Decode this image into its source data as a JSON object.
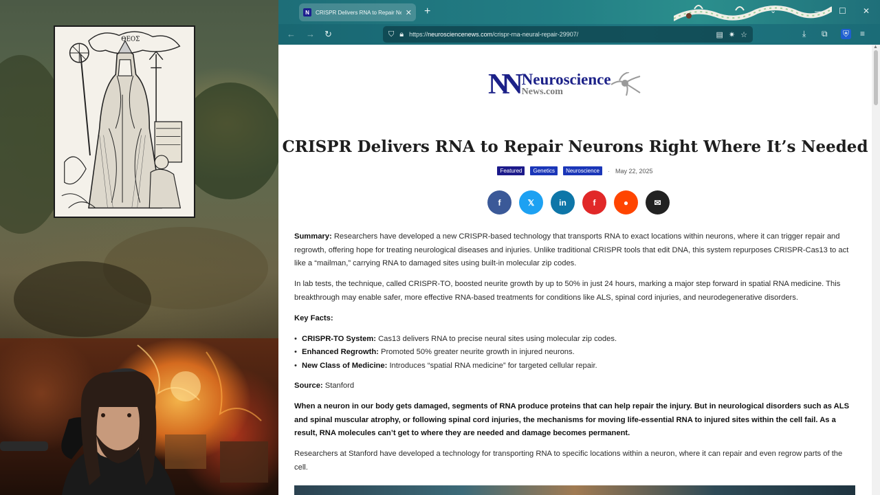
{
  "browser": {
    "tab_title": "CRISPR Delivers RNA to Repair Neurons Right Where It's Needed",
    "favicon_text": "N",
    "url_prefix": "https://",
    "url_host": "neurosciencenews.com",
    "url_path": "/crispr-rna-neural-repair-29907/"
  },
  "site": {
    "logo_mark": "NN",
    "logo_line1": "Neuroscience",
    "logo_line2": "News.com"
  },
  "article": {
    "headline": "CRISPR Delivers RNA to Repair Neurons Right Where It’s Needed",
    "tags": [
      "Featured",
      "Genetics",
      "Neuroscience"
    ],
    "date": "May 22, 2025",
    "summary_label": "Summary:",
    "summary_text": " Researchers have developed a new CRISPR-based technology that transports RNA to exact locations within neurons, where it can trigger repair and regrowth, offering hope for treating neurological diseases and injuries. Unlike traditional CRISPR tools that edit DNA, this system repurposes CRISPR-Cas13 to act like a “mailman,” carrying RNA to damaged sites using built-in molecular zip codes.",
    "para2": "In lab tests, the technique, called CRISPR-TO, boosted neurite growth by up to 50% in just 24 hours, marking a major step forward in spatial RNA medicine. This breakthrough may enable safer, more effective RNA-based treatments for conditions like ALS, spinal cord injuries, and neurodegenerative disorders.",
    "key_facts_label": "Key Facts:",
    "key_facts": [
      {
        "label": "CRISPR-TO System:",
        "text": " Cas13 delivers RNA to precise neural sites using molecular zip codes."
      },
      {
        "label": "Enhanced Regrowth:",
        "text": " Promoted 50% greater neurite growth in injured neurons."
      },
      {
        "label": "New Class of Medicine:",
        "text": " Introduces “spatial RNA medicine” for targeted cellular repair."
      }
    ],
    "source_label": "Source:",
    "source_text": " Stanford",
    "lead": "When a neuron in our body gets damaged, segments of RNA produce proteins that can help repair the injury. But in neurological disorders such as ALS and spinal muscular atrophy, or following spinal cord injuries, the mechanisms for moving life-essential RNA to injured sites within the cell fail. As a result, RNA molecules can’t get to where they are needed and damage becomes permanent.",
    "para3": "Researchers at Stanford have developed a technology for transporting RNA to specific locations within a neuron, where it can repair and even regrow parts of the cell."
  },
  "engraving": {
    "caption": "ΘΕΟΣ"
  },
  "share_buttons": [
    {
      "name": "facebook",
      "glyph": "f",
      "color": "#3b5998"
    },
    {
      "name": "x",
      "glyph": "𝕏",
      "color": "#1da1f2"
    },
    {
      "name": "linkedin",
      "glyph": "in",
      "color": "#0e76a8"
    },
    {
      "name": "flipboard",
      "glyph": "f",
      "color": "#e12828"
    },
    {
      "name": "reddit",
      "glyph": "●",
      "color": "#ff4500"
    },
    {
      "name": "email",
      "glyph": "✉",
      "color": "#222222"
    }
  ]
}
